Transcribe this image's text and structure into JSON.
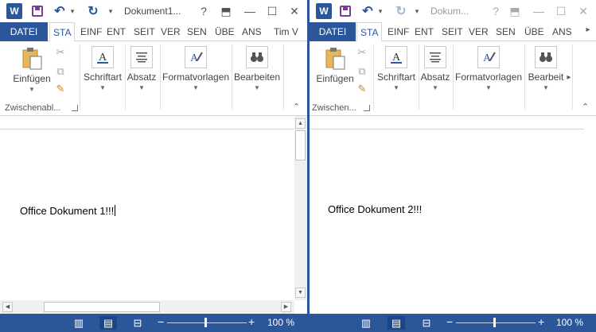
{
  "colors": {
    "accent": "#2b579a",
    "save": "#7c3b95",
    "statusbar": "#2b579a"
  },
  "left": {
    "app_icon": "W",
    "title": "Dokument1...",
    "help": "?",
    "restore_ribbon": "⬒",
    "minimize": "—",
    "maximize": "☐",
    "close": "✕",
    "tabs": [
      "DATEI",
      "STA",
      "EINF",
      "ENT",
      "SEIT",
      "VER",
      "SEN",
      "ÜBE",
      "ANS"
    ],
    "user": "Tim V",
    "ribbon": {
      "paste": "Einfügen",
      "font": "Schriftart",
      "paragraph": "Absatz",
      "styles": "Formatvorlagen",
      "editing": "Bearbeiten",
      "clipboard_group": "Zwischenabl..."
    },
    "text": "Office Dokument 1!!!",
    "zoom": "100 %"
  },
  "right": {
    "app_icon": "W",
    "title": "Dokum...",
    "help": "?",
    "restore_ribbon": "⬒",
    "minimize": "—",
    "maximize": "☐",
    "close": "✕",
    "tabs": [
      "DATEI",
      "STA",
      "EINF",
      "ENT",
      "SEIT",
      "VER",
      "SEN",
      "ÜBE",
      "ANS"
    ],
    "ribbon": {
      "paste": "Einfügen",
      "font": "Schriftart",
      "paragraph": "Absatz",
      "styles": "Formatvorlagen",
      "editing": "Bearbeit",
      "clipboard_group": "Zwischen..."
    },
    "text": "Office Dokument 2!!!",
    "zoom": "100 %"
  }
}
